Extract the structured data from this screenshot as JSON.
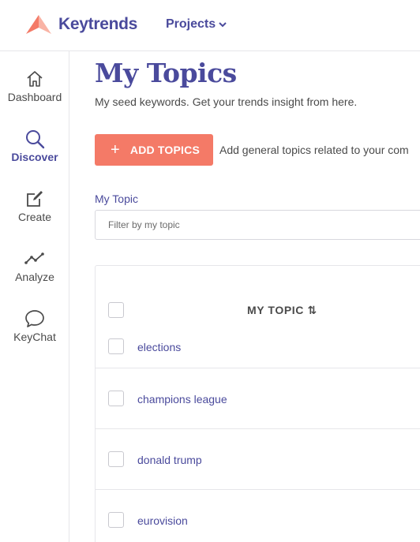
{
  "header": {
    "brand": "Keytrends",
    "projects_label": "Projects",
    "brand_color": "#4a4a9c",
    "accent_color": "#f47a67"
  },
  "sidebar": {
    "items": [
      {
        "label": "Dashboard",
        "icon": "home-icon",
        "active": false
      },
      {
        "label": "Discover",
        "icon": "search-icon",
        "active": true
      },
      {
        "label": "Create",
        "icon": "edit-icon",
        "active": false
      },
      {
        "label": "Analyze",
        "icon": "chart-line-icon",
        "active": false
      },
      {
        "label": "KeyChat",
        "icon": "chat-bubble-icon",
        "active": false
      }
    ]
  },
  "main": {
    "title": "My Topics",
    "subtitle": "My seed keywords. Get your trends insight from here.",
    "add_button": "ADD TOPICS",
    "add_helper": "Add general topics related to your com",
    "filter_label": "My Topic",
    "filter_placeholder": "Filter by my topic",
    "table": {
      "header": "MY TOPIC ⇅",
      "rows": [
        "elections",
        "champions league",
        "donald trump",
        "eurovision"
      ]
    }
  }
}
